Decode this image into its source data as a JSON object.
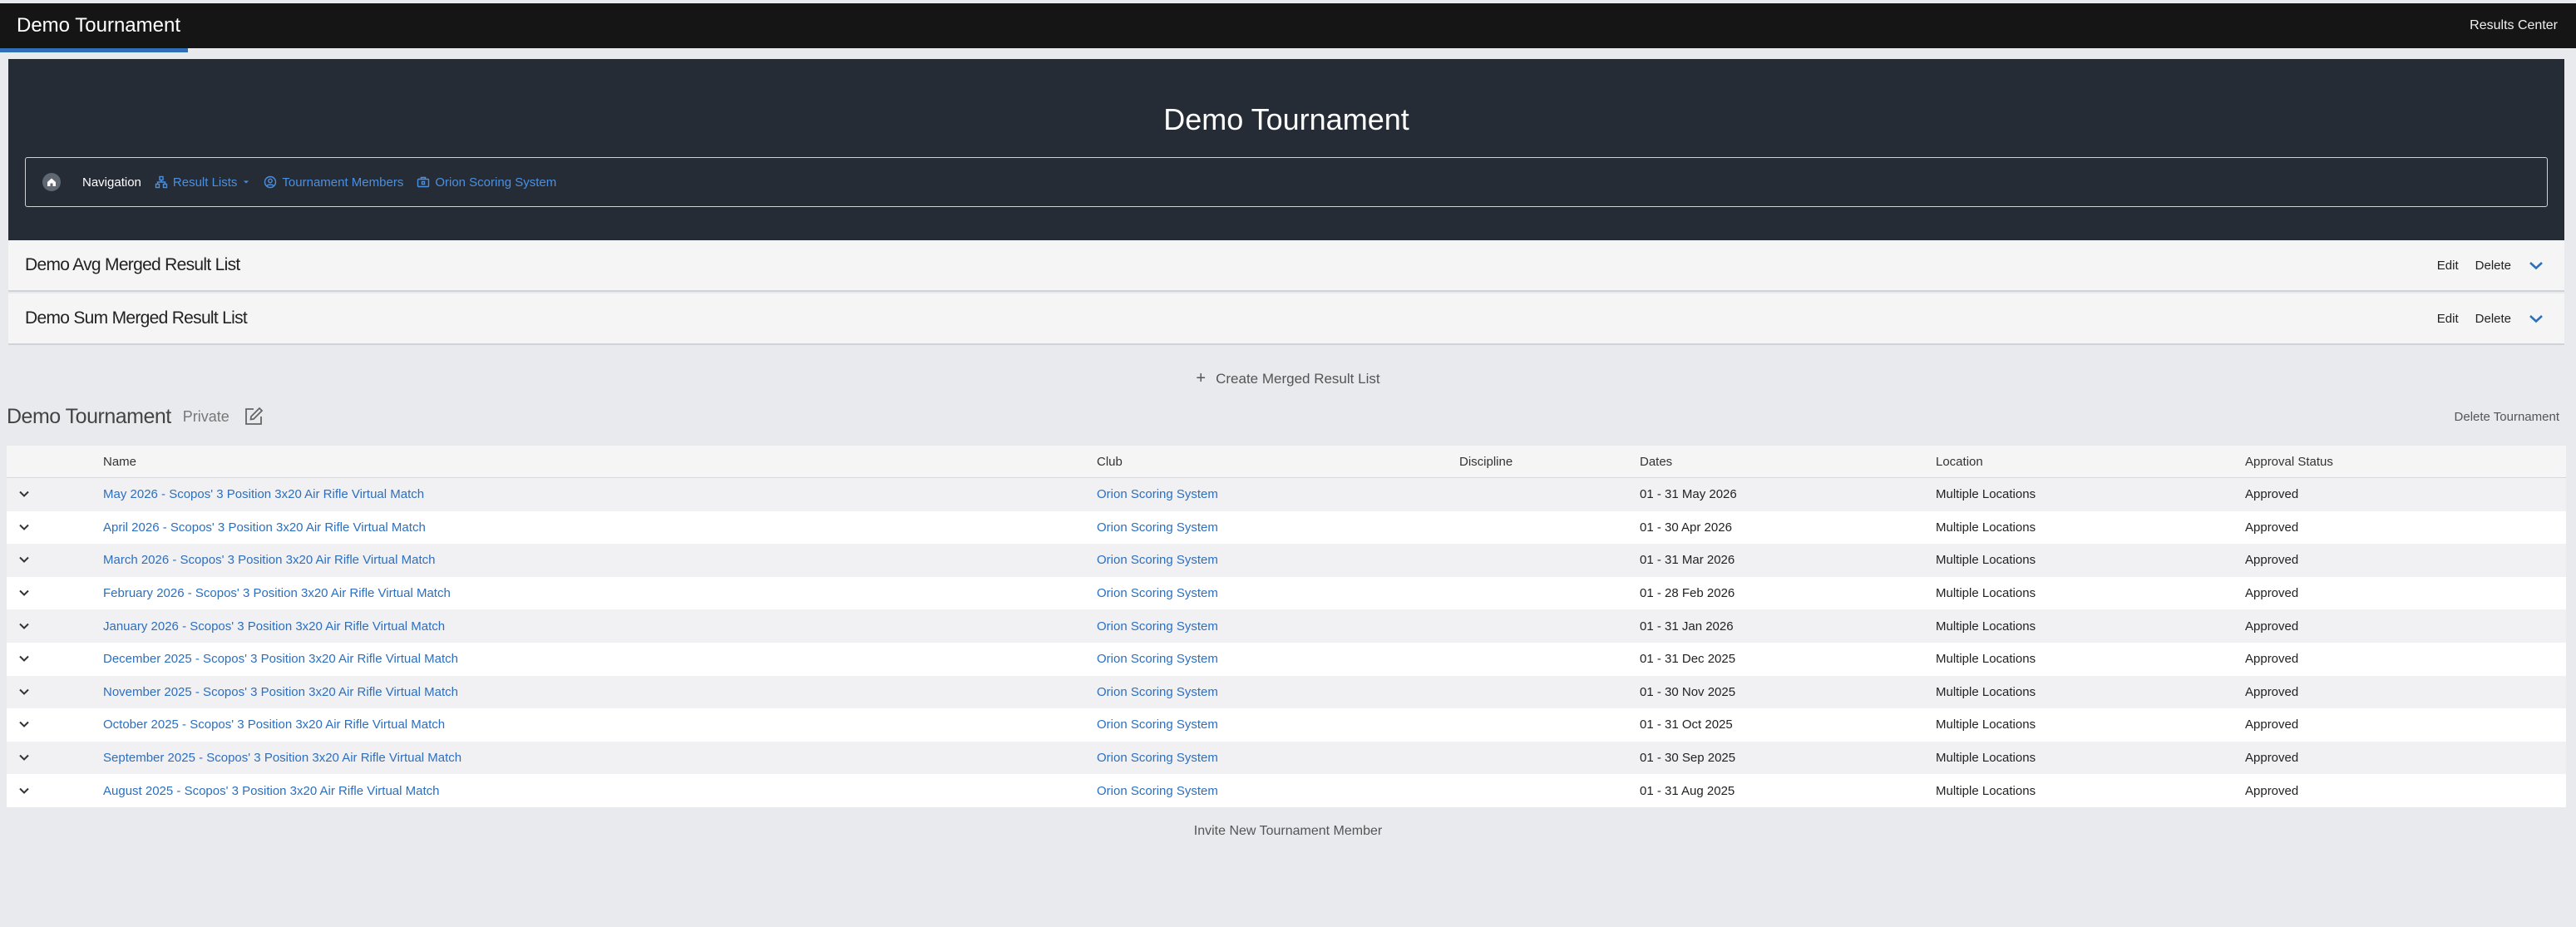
{
  "topbar": {
    "title": "Demo Tournament",
    "results_center": "Results Center"
  },
  "hero": {
    "title": "Demo Tournament"
  },
  "nav": {
    "label": "Navigation",
    "result_lists": "Result Lists",
    "tournament_members": "Tournament Members",
    "orion_scoring": "Orion Scoring System"
  },
  "merged_lists": [
    {
      "title": "Demo Avg Merged Result List",
      "edit": "Edit",
      "delete": "Delete"
    },
    {
      "title": "Demo Sum Merged Result List",
      "edit": "Edit",
      "delete": "Delete"
    }
  ],
  "create_merged": "Create Merged Result List",
  "tournament": {
    "title": "Demo Tournament",
    "visibility": "Private",
    "delete": "Delete Tournament"
  },
  "table": {
    "headers": [
      "Name",
      "Club",
      "Discipline",
      "Dates",
      "Location",
      "Approval Status"
    ],
    "rows": [
      {
        "name": "May 2026 - Scopos' 3 Position 3x20 Air Rifle Virtual Match",
        "club": "Orion Scoring System",
        "discipline": "",
        "dates": "01 - 31 May 2026",
        "location": "Multiple Locations",
        "status": "Approved"
      },
      {
        "name": "April 2026 - Scopos' 3 Position 3x20 Air Rifle Virtual Match",
        "club": "Orion Scoring System",
        "discipline": "",
        "dates": "01 - 30 Apr 2026",
        "location": "Multiple Locations",
        "status": "Approved"
      },
      {
        "name": "March 2026 - Scopos' 3 Position 3x20 Air Rifle Virtual Match",
        "club": "Orion Scoring System",
        "discipline": "",
        "dates": "01 - 31 Mar 2026",
        "location": "Multiple Locations",
        "status": "Approved"
      },
      {
        "name": "February 2026 - Scopos' 3 Position 3x20 Air Rifle Virtual Match",
        "club": "Orion Scoring System",
        "discipline": "",
        "dates": "01 - 28 Feb 2026",
        "location": "Multiple Locations",
        "status": "Approved"
      },
      {
        "name": "January 2026 - Scopos' 3 Position 3x20 Air Rifle Virtual Match",
        "club": "Orion Scoring System",
        "discipline": "",
        "dates": "01 - 31 Jan 2026",
        "location": "Multiple Locations",
        "status": "Approved"
      },
      {
        "name": "December 2025 - Scopos' 3 Position 3x20 Air Rifle Virtual Match",
        "club": "Orion Scoring System",
        "discipline": "",
        "dates": "01 - 31 Dec 2025",
        "location": "Multiple Locations",
        "status": "Approved"
      },
      {
        "name": "November 2025 - Scopos' 3 Position 3x20 Air Rifle Virtual Match",
        "club": "Orion Scoring System",
        "discipline": "",
        "dates": "01 - 30 Nov 2025",
        "location": "Multiple Locations",
        "status": "Approved"
      },
      {
        "name": "October 2025 - Scopos' 3 Position 3x20 Air Rifle Virtual Match",
        "club": "Orion Scoring System",
        "discipline": "",
        "dates": "01 - 31 Oct 2025",
        "location": "Multiple Locations",
        "status": "Approved"
      },
      {
        "name": "September 2025 - Scopos' 3 Position 3x20 Air Rifle Virtual Match",
        "club": "Orion Scoring System",
        "discipline": "",
        "dates": "01 - 30 Sep 2025",
        "location": "Multiple Locations",
        "status": "Approved"
      },
      {
        "name": "August 2025 - Scopos' 3 Position 3x20 Air Rifle Virtual Match",
        "club": "Orion Scoring System",
        "discipline": "",
        "dates": "01 - 31 Aug 2025",
        "location": "Multiple Locations",
        "status": "Approved"
      }
    ]
  },
  "invite": "Invite New Tournament Member",
  "colors": {
    "accent": "#2f6fb5",
    "link": "#2c6fbf",
    "hero_bg": "#262c36",
    "topbar_bg": "#151515"
  }
}
